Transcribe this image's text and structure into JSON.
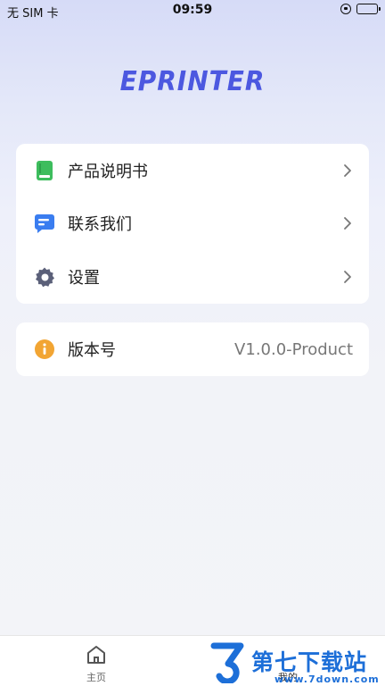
{
  "status_bar": {
    "carrier": "无 SIM 卡",
    "time": "09:59"
  },
  "app": {
    "logo_text": "EPRINTER",
    "brand_color": "#4c58e0"
  },
  "menu": {
    "items": [
      {
        "label": "产品说明书",
        "icon": "manual-book-icon",
        "icon_color": "#3dbd5d"
      },
      {
        "label": "联系我们",
        "icon": "chat-message-icon",
        "icon_color": "#3a7df0"
      },
      {
        "label": "设置",
        "icon": "gear-icon",
        "icon_color": "#5b6079"
      }
    ]
  },
  "version": {
    "label": "版本号",
    "value": "V1.0.0-Product",
    "icon": "info-icon",
    "icon_color": "#f2a533"
  },
  "tabbar": {
    "home_label": "主页",
    "mine_label": "我的"
  },
  "watermark": {
    "text": "第七下载站",
    "url": "www.7down.com"
  }
}
